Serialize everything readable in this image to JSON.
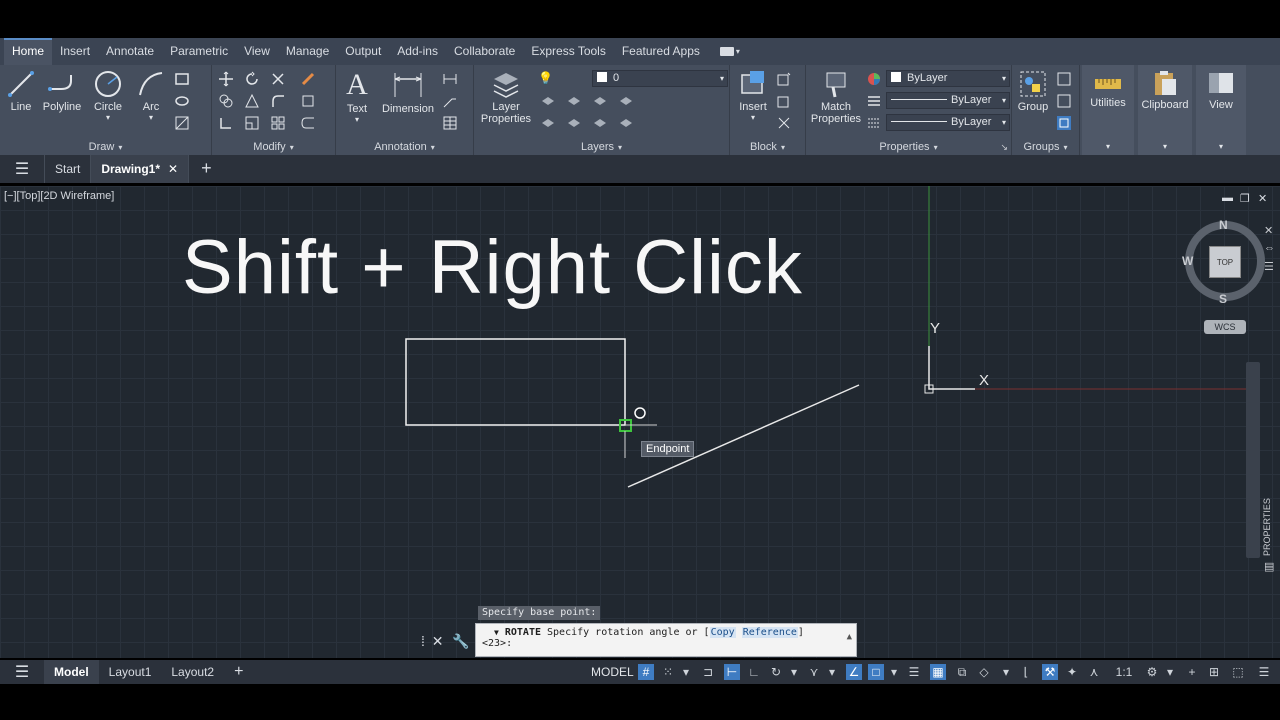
{
  "ribbon": {
    "tabs": [
      "Home",
      "Insert",
      "Annotate",
      "Parametric",
      "View",
      "Manage",
      "Output",
      "Add-ins",
      "Collaborate",
      "Express Tools",
      "Featured Apps"
    ],
    "active_tab": "Home",
    "panels": {
      "draw": {
        "title": "Draw",
        "tools": [
          "Line",
          "Polyline",
          "Circle",
          "Arc"
        ]
      },
      "modify": {
        "title": "Modify"
      },
      "annotation": {
        "title": "Annotation",
        "tools": [
          "Text",
          "Dimension"
        ]
      },
      "layers": {
        "title": "Layers",
        "tool": "Layer\nProperties",
        "tool_l1": "Layer",
        "tool_l2": "Properties",
        "layer_value": "0"
      },
      "block": {
        "title": "Block",
        "tool": "Insert"
      },
      "properties": {
        "title": "Properties",
        "tool_l1": "Match",
        "tool_l2": "Properties",
        "color_value": "ByLayer",
        "linetype_value": "ByLayer",
        "lineweight_value": "ByLayer"
      },
      "groups": {
        "title": "Groups",
        "tool": "Group"
      }
    },
    "side_buttons": [
      "Utilities",
      "Clipboard",
      "View"
    ]
  },
  "file_tabs": {
    "tabs": [
      "Start",
      "Drawing1*"
    ],
    "active": "Drawing1*"
  },
  "viewport": {
    "label": "[−][Top][2D Wireframe]",
    "overlay_text": "Shift + Right Click",
    "tooltip": "Endpoint",
    "viewcube": {
      "top": "TOP",
      "n": "N",
      "s": "S",
      "w": "W",
      "wcs": "WCS"
    },
    "ucs": {
      "y": "Y",
      "x": "X"
    },
    "properties_palette": "PROPERTIES"
  },
  "command": {
    "history": "Specify base point:",
    "prompt_cmd": "ROTATE",
    "prompt_text": "Specify rotation angle or [",
    "option1": "Copy",
    "option2": "Reference",
    "prompt_end": "]",
    "prompt_line2": "<23>:"
  },
  "statusbar": {
    "tabs": [
      "Model",
      "Layout1",
      "Layout2"
    ],
    "active": "Model",
    "model_label": "MODEL",
    "scale": "1:1"
  },
  "colors": {
    "canvas_bg": "#212830",
    "ribbon_bg": "#454e5d",
    "accent_blue": "#3f7cc2",
    "grip_green": "#3ec43e"
  }
}
